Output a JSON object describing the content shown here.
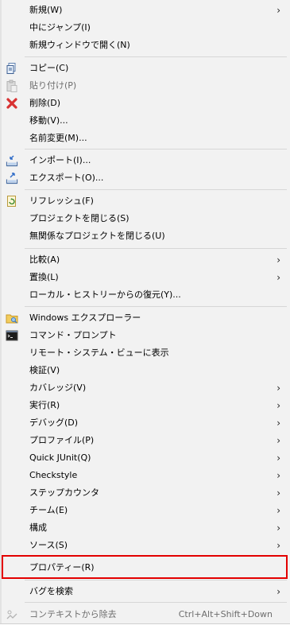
{
  "menu": {
    "items": [
      {
        "label": "新規(W)",
        "submenu": true
      },
      {
        "label": "中にジャンプ(I)"
      },
      {
        "label": "新規ウィンドウで開く(N)"
      },
      {
        "label": "コピー(C)",
        "icon": "copy-icon"
      },
      {
        "label": "貼り付け(P)",
        "icon": "paste-icon",
        "disabled": true
      },
      {
        "label": "削除(D)",
        "icon": "delete-icon"
      },
      {
        "label": "移動(V)..."
      },
      {
        "label": "名前変更(M)..."
      },
      {
        "label": "インポート(I)...",
        "icon": "import-icon"
      },
      {
        "label": "エクスポート(O)...",
        "icon": "export-icon"
      },
      {
        "label": "リフレッシュ(F)",
        "icon": "refresh-icon"
      },
      {
        "label": "プロジェクトを閉じる(S)"
      },
      {
        "label": "無関係なプロジェクトを閉じる(U)"
      },
      {
        "label": "比較(A)",
        "submenu": true
      },
      {
        "label": "置換(L)",
        "submenu": true
      },
      {
        "label": "ローカル・ヒストリーからの復元(Y)..."
      },
      {
        "label": "Windows エクスプローラー",
        "icon": "explorer-folder-icon"
      },
      {
        "label": "コマンド・プロンプト",
        "icon": "command-prompt-icon"
      },
      {
        "label": "リモート・システム・ビューに表示"
      },
      {
        "label": "検証(V)"
      },
      {
        "label": "カバレッジ(V)",
        "submenu": true
      },
      {
        "label": "実行(R)",
        "submenu": true
      },
      {
        "label": "デバッグ(D)",
        "submenu": true
      },
      {
        "label": "プロファイル(P)",
        "submenu": true
      },
      {
        "label": "Quick JUnit(Q)",
        "submenu": true
      },
      {
        "label": "Checkstyle",
        "submenu": true
      },
      {
        "label": "ステップカウンタ",
        "submenu": true
      },
      {
        "label": "チーム(E)",
        "submenu": true
      },
      {
        "label": "構成",
        "submenu": true
      },
      {
        "label": "ソース(S)",
        "submenu": true
      },
      {
        "label": "プロパティー(R)",
        "highlighted": true
      },
      {
        "label": "バグを検索",
        "submenu": true
      },
      {
        "label": "コンテキストから除去",
        "icon": "remove-context-icon",
        "disabled": true,
        "shortcut": "Ctrl+Alt+Shift+Down"
      }
    ],
    "chevron": "›"
  },
  "colors": {
    "menu_bg": "#f2f2f2",
    "highlight_border": "#e30000",
    "disabled_text": "#6d6d6d"
  }
}
